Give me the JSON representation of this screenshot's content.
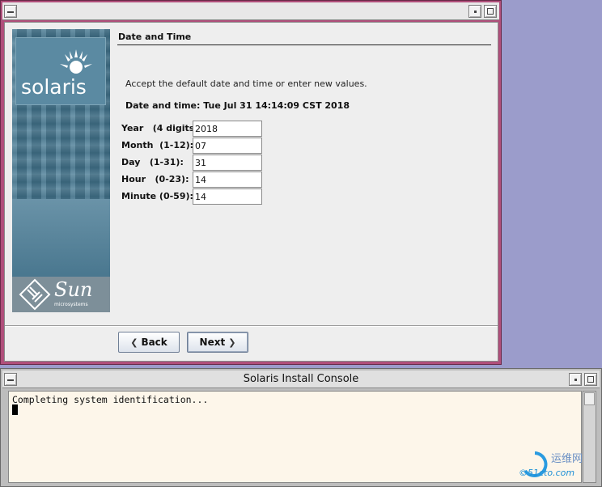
{
  "installer": {
    "banner": {
      "brand_top": "solaris",
      "brand_bottom": "Sun",
      "brand_bottom_sub": "microsystems"
    },
    "page_title": "Date and Time",
    "instructions": "Accept the default date and time or enter new values.",
    "datetime_line": "Date and time: Tue Jul 31 14:14:09 CST 2018",
    "fields": [
      {
        "label": "Year   (4 digits):",
        "value": "2018"
      },
      {
        "label": "Month  (1-12):",
        "value": "07"
      },
      {
        "label": "Day   (1-31):",
        "value": "31"
      },
      {
        "label": "Hour   (0-23):",
        "value": "14"
      },
      {
        "label": "Minute (0-59):",
        "value": "14"
      }
    ],
    "buttons": {
      "back": "Back",
      "next": "Next"
    }
  },
  "console": {
    "title": "Solaris Install Console",
    "text": "Completing system identification..."
  },
  "watermark": {
    "cn": "运维网",
    "site": "©51cto.com"
  },
  "colors": {
    "desktop": "#9b9ccb",
    "installer_frame": "#b04f7b",
    "console_bg": "#fdf6ea"
  }
}
